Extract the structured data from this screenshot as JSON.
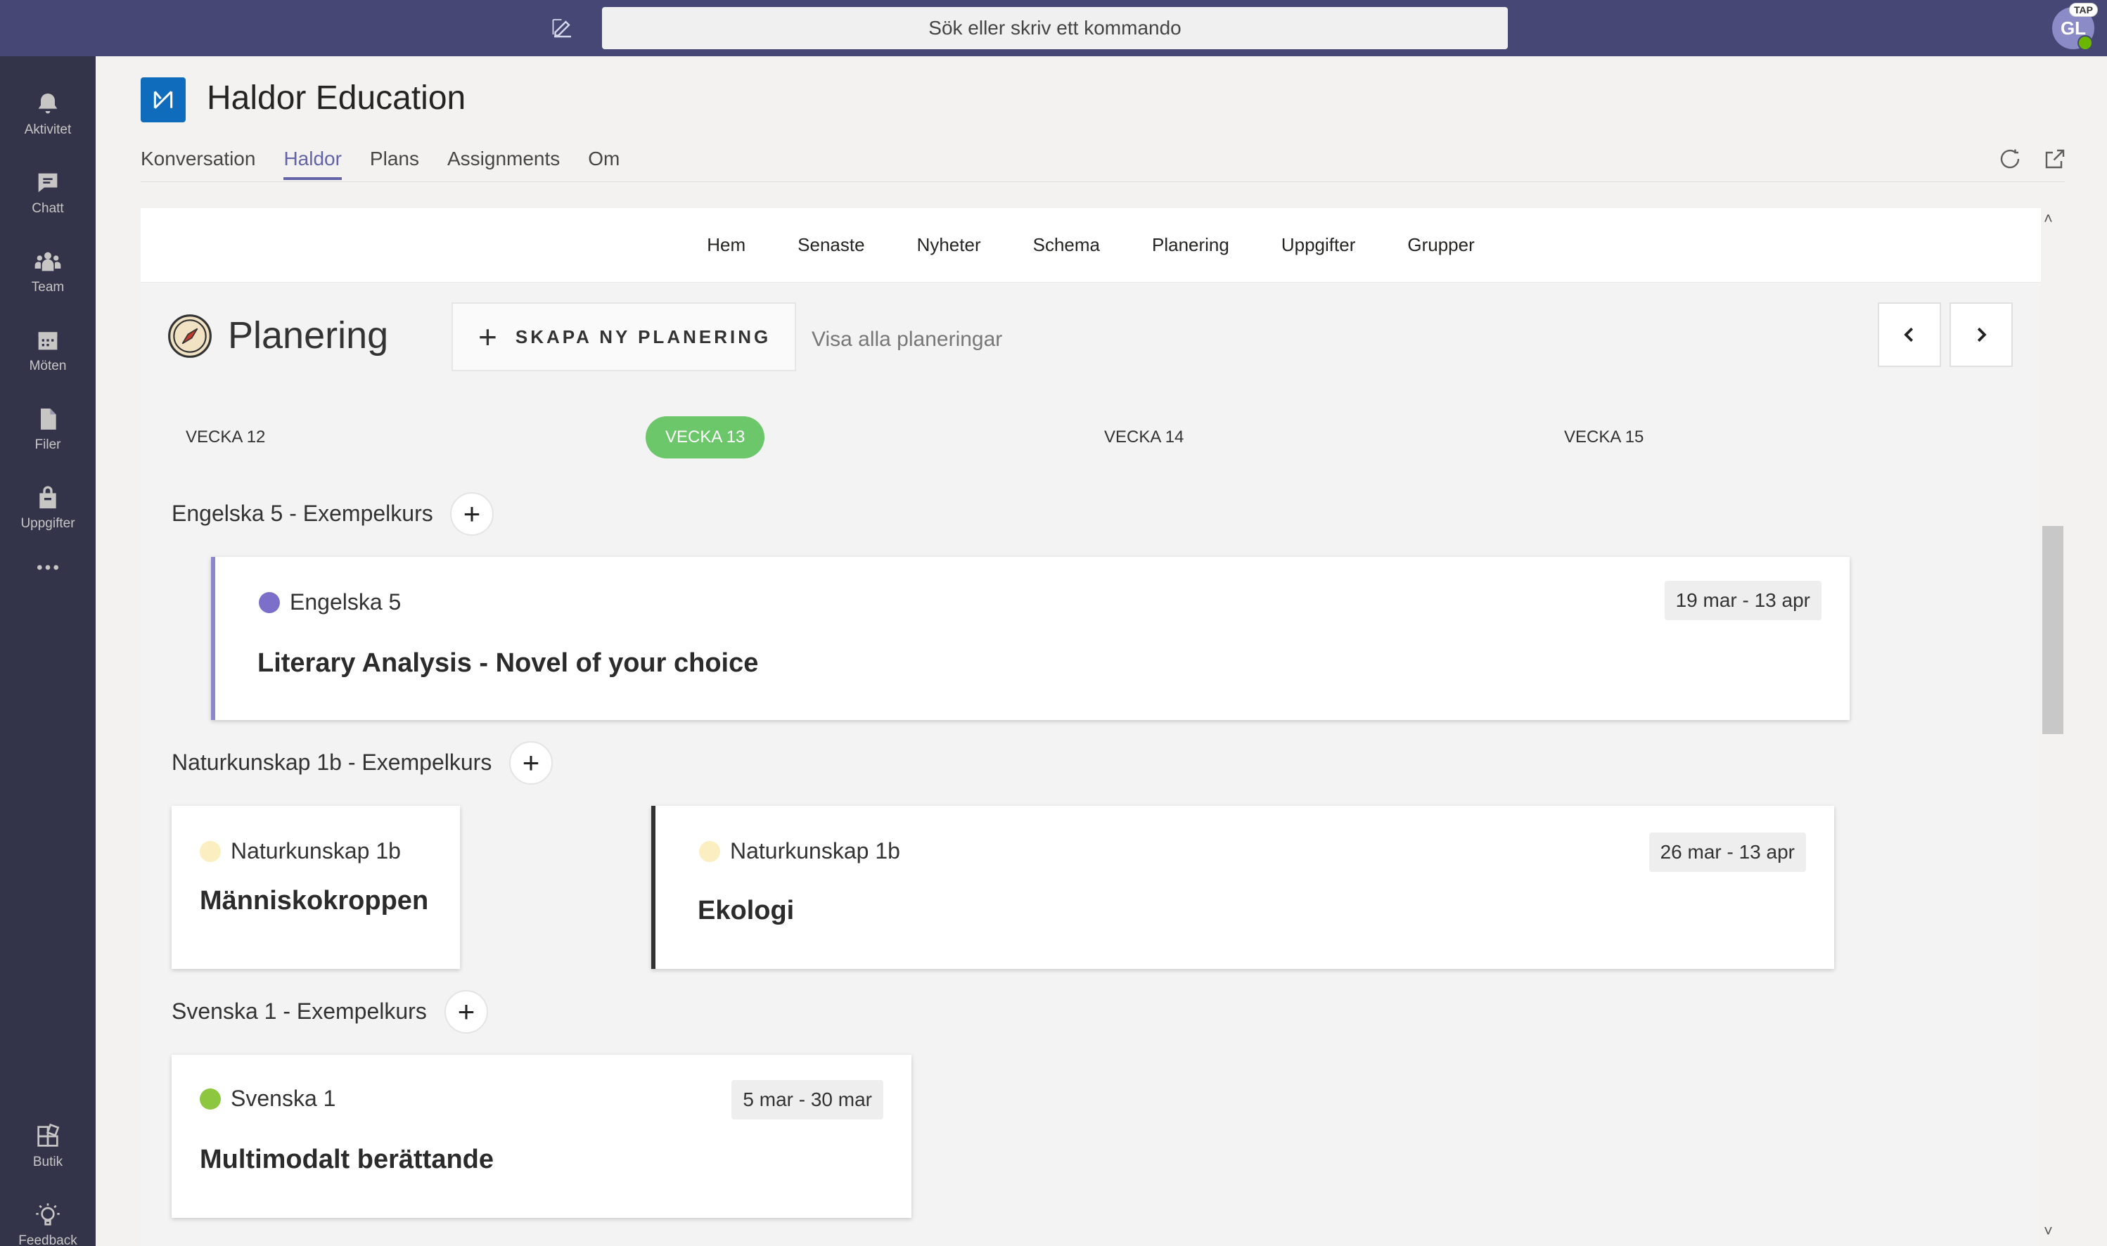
{
  "topbar": {
    "search_placeholder": "Sök eller skriv ett kommando",
    "avatar_initials": "GL",
    "avatar_tag": "TAP",
    "colors": {
      "bar": "#464775"
    }
  },
  "rail": {
    "items": [
      {
        "label": "Aktivitet",
        "icon": "bell-icon"
      },
      {
        "label": "Chatt",
        "icon": "chat-icon"
      },
      {
        "label": "Team",
        "icon": "team-icon"
      },
      {
        "label": "Möten",
        "icon": "calendar-icon"
      },
      {
        "label": "Filer",
        "icon": "file-icon"
      },
      {
        "label": "Uppgifter",
        "icon": "bag-icon"
      },
      {
        "label": "",
        "icon": "more-icon"
      }
    ],
    "bottom": [
      {
        "label": "Butik",
        "icon": "apps-icon"
      },
      {
        "label": "Feedback",
        "icon": "lightbulb-icon"
      }
    ]
  },
  "app": {
    "title": "Haldor Education",
    "tabs": [
      "Konversation",
      "Haldor",
      "Plans",
      "Assignments",
      "Om"
    ],
    "active_tab": "Haldor"
  },
  "subnav": [
    "Hem",
    "Senaste",
    "Nyheter",
    "Schema",
    "Planering",
    "Uppgifter",
    "Grupper"
  ],
  "planning": {
    "title": "Planering",
    "create_label": "SKAPA NY PLANERING",
    "view_all": "Visa alla planeringar",
    "weeks": [
      "VECKA 12",
      "VECKA 13",
      "VECKA 14",
      "VECKA 15"
    ],
    "active_week": "VECKA 13",
    "groups": [
      {
        "title": "Engelska 5 - Exempelkurs",
        "cards": [
          {
            "subject": "Engelska 5",
            "dot": "#7c6fc9",
            "title": "Literary Analysis - Novel of your choice",
            "dates": "19 mar - 13 apr"
          }
        ]
      },
      {
        "title": "Naturkunskap 1b - Exempelkurs",
        "cards": [
          {
            "subject": "Naturkunskap 1b",
            "dot": "#fbeec0",
            "title": "Människokroppen",
            "dates": ""
          },
          {
            "subject": "Naturkunskap 1b",
            "dot": "#fbeec0",
            "title": "Ekologi",
            "dates": "26 mar - 13 apr"
          }
        ]
      },
      {
        "title": "Svenska 1 - Exempelkurs",
        "cards": [
          {
            "subject": "Svenska 1",
            "dot": "#8dc63f",
            "title": "Multimodalt berättande",
            "dates": "5 mar - 30 mar"
          }
        ]
      }
    ]
  }
}
